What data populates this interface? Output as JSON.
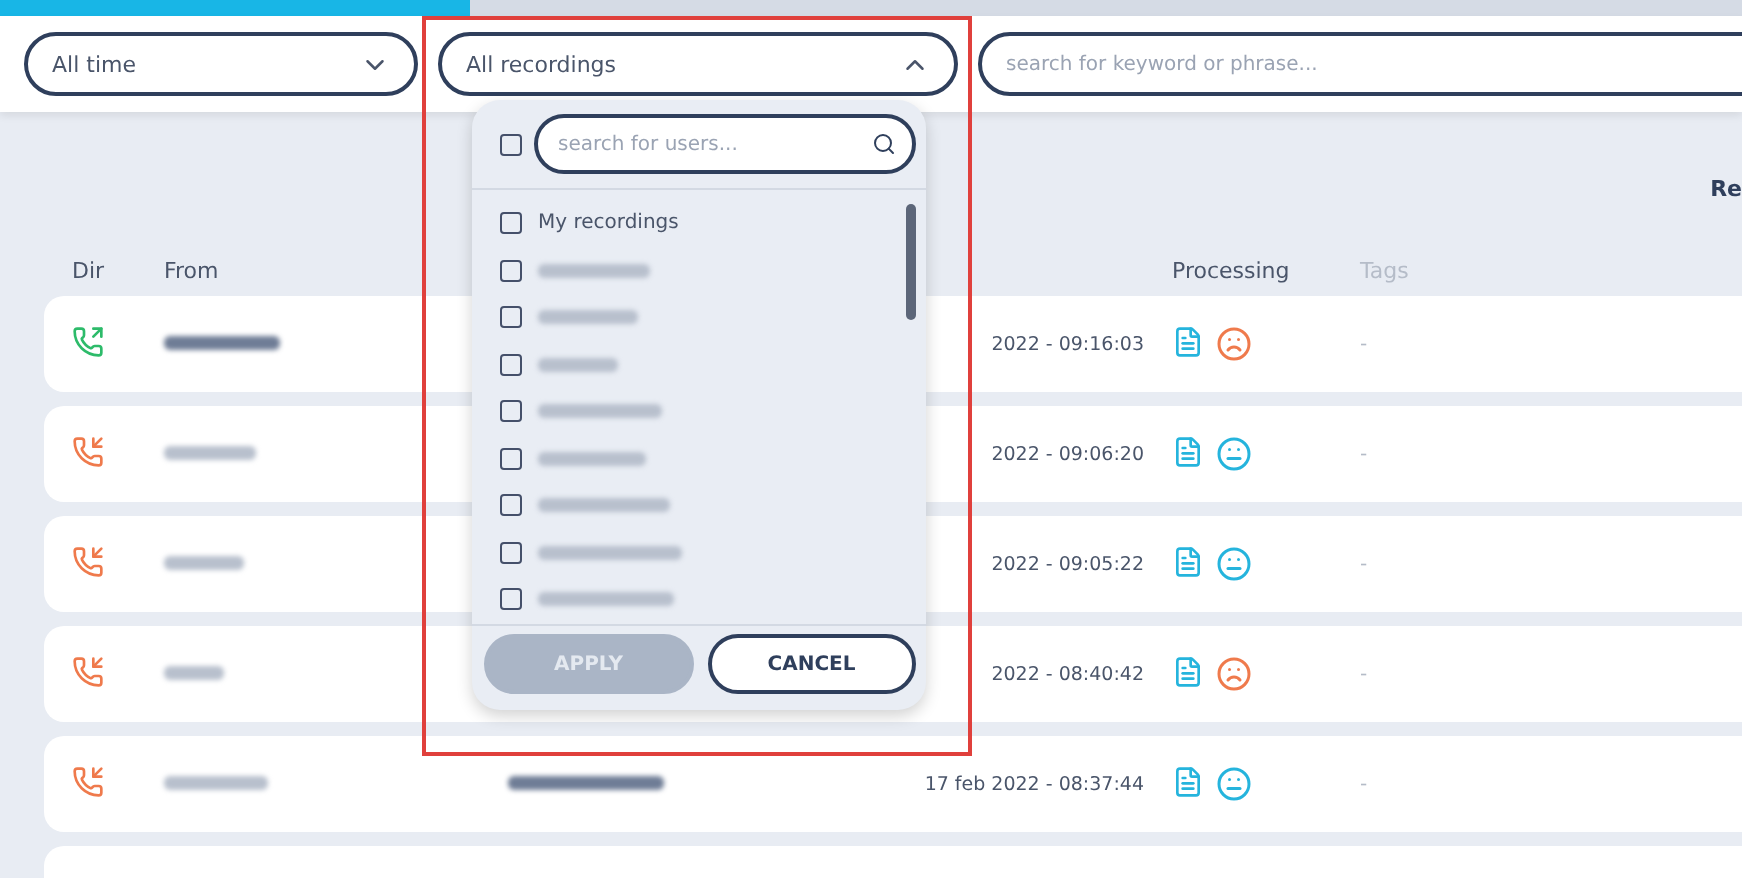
{
  "progress": {
    "level": 0.27
  },
  "filters": {
    "time": {
      "value": "All time",
      "expanded": false
    },
    "recordings": {
      "value": "All recordings",
      "expanded": true
    },
    "search": {
      "placeholder": "search for keyword or phrase..."
    }
  },
  "header_action": "Re",
  "columns": [
    "Dir",
    "From",
    "Processing",
    "Tags"
  ],
  "rows": [
    {
      "outgoing": true,
      "from_redacted": true,
      "date": "2022 - 09:16:03",
      "negative": true,
      "tags": "-"
    },
    {
      "outgoing": false,
      "from_redacted": true,
      "date": "2022 - 09:06:20",
      "negative": false,
      "tags": "-"
    },
    {
      "outgoing": false,
      "from_redacted": true,
      "date": "2022 - 09:05:22",
      "negative": false,
      "tags": "-"
    },
    {
      "outgoing": false,
      "from_redacted": true,
      "date": "2022 - 08:40:42",
      "negative": true,
      "tags": "-"
    },
    {
      "outgoing": false,
      "from_redacted": true,
      "to_redacted": true,
      "date": "17 feb 2022 - 08:37:44",
      "negative": false,
      "tags": "-"
    }
  ],
  "dropdown": {
    "select_all_checked": false,
    "search_placeholder": "search for users...",
    "users": [
      {
        "label": "My recordings",
        "checked": false,
        "redacted": false
      },
      {
        "checked": false,
        "redacted": true
      },
      {
        "checked": false,
        "redacted": true
      },
      {
        "checked": false,
        "redacted": true
      },
      {
        "checked": false,
        "redacted": true
      },
      {
        "checked": false,
        "redacted": true
      },
      {
        "checked": false,
        "redacted": true
      },
      {
        "checked": false,
        "redacted": true
      },
      {
        "checked": false,
        "redacted": true
      }
    ],
    "apply": {
      "label": "APPLY",
      "disabled": true
    },
    "cancel": {
      "label": "CANCEL",
      "disabled": false
    }
  },
  "highlight_frame": true
}
